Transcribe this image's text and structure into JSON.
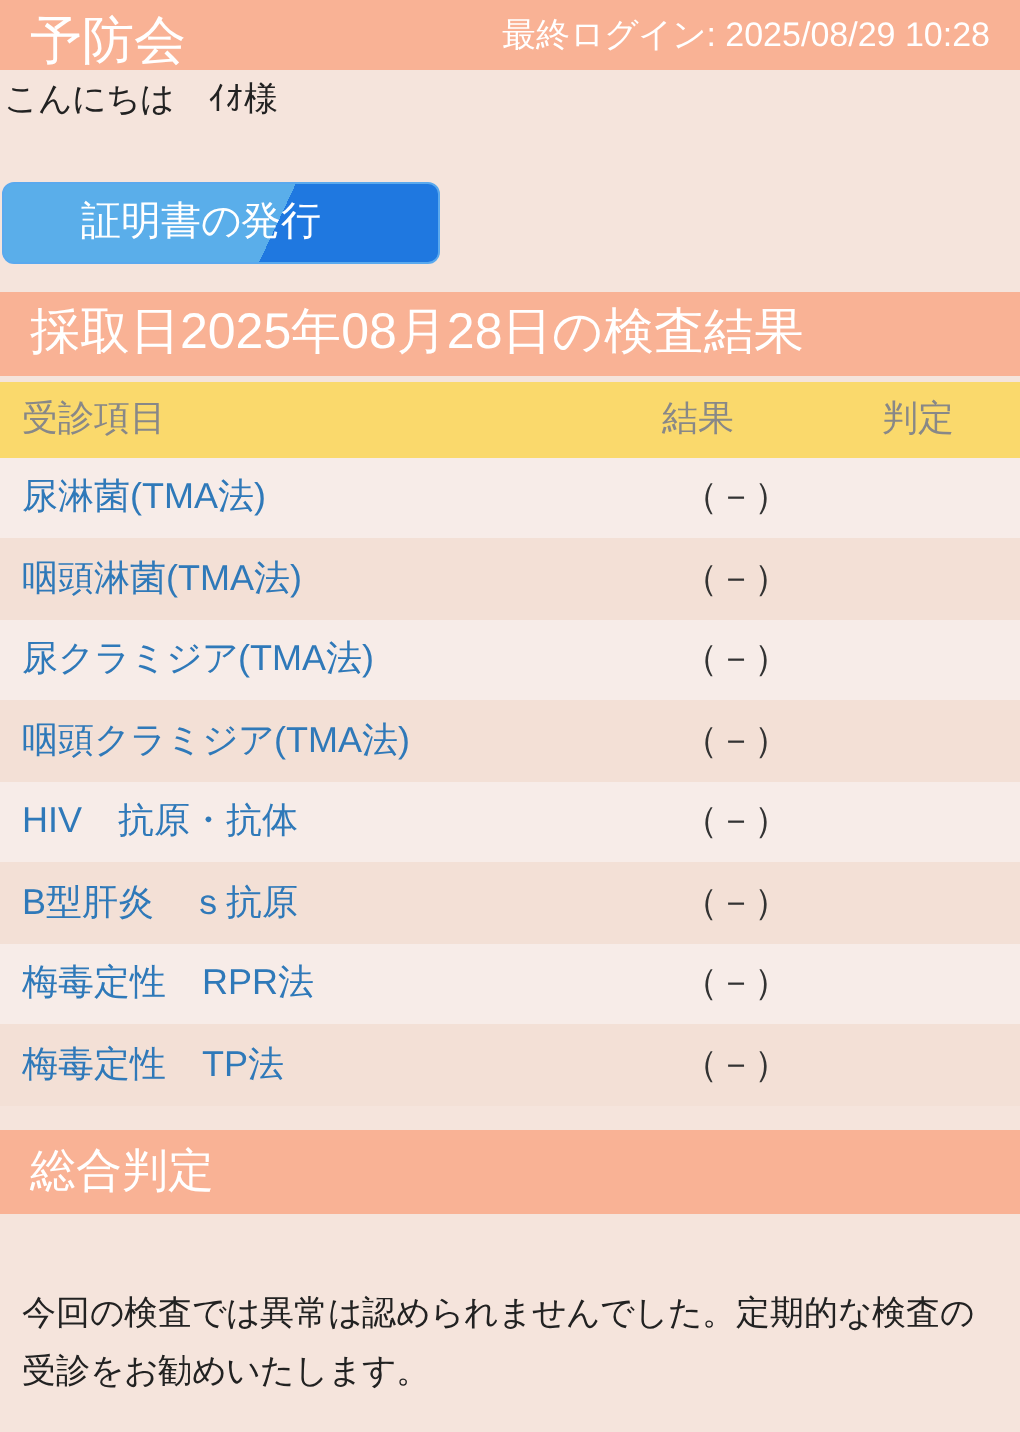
{
  "header": {
    "title": "予防会",
    "last_login": "最終ログイン: 2025/08/29 10:28"
  },
  "greeting": "こんにちは　ｲｵ様",
  "certificate_button": "証明書の発行",
  "results_title": "採取日2025年08月28日の検査結果",
  "table": {
    "columns": [
      "受診項目",
      "結果",
      "判定"
    ],
    "rows": [
      {
        "item": "尿淋菌(TMA法)",
        "result": "（－）"
      },
      {
        "item": "咽頭淋菌(TMA法)",
        "result": "（－）"
      },
      {
        "item": "尿クラミジア(TMA法)",
        "result": "（－）"
      },
      {
        "item": "咽頭クラミジア(TMA法)",
        "result": "（－）"
      },
      {
        "item": "HIV　抗原・抗体",
        "result": "（－）"
      },
      {
        "item": "B型肝炎　ｓ抗原",
        "result": "（－）"
      },
      {
        "item": "梅毒定性　RPR法",
        "result": "（－）"
      },
      {
        "item": "梅毒定性　TP法",
        "result": "（－）"
      }
    ]
  },
  "summary": {
    "title": "総合判定",
    "text": "今回の検査では異常は認められませんでした。定期的な検査の受診をお勧めいたします。"
  }
}
